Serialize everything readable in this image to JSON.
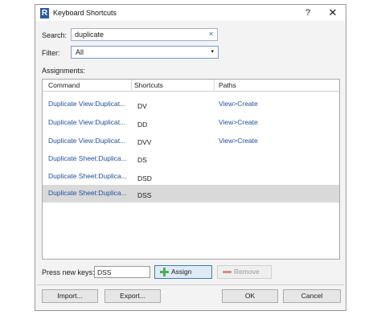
{
  "window": {
    "title": "Keyboard Shortcuts",
    "help_label": "?",
    "close_label": "✕",
    "app_icon_letter": "R"
  },
  "search": {
    "label": "Search:",
    "value": "duplicate",
    "clear_label": "✕"
  },
  "filter": {
    "label": "Filter:",
    "value": "All",
    "chevron": "▾"
  },
  "assignments": {
    "label": "Assignments:",
    "columns": [
      "Command",
      "Shortcuts",
      "Paths"
    ],
    "rows": [
      {
        "command": "Duplicate View:Duplicat...",
        "shortcut": "DV",
        "path": "View>Create",
        "selected": false
      },
      {
        "command": "Duplicate View:Duplicat...",
        "shortcut": "DD",
        "path": "View>Create",
        "selected": false
      },
      {
        "command": "Duplicate View:Duplicat...",
        "shortcut": "DVV",
        "path": "View>Create",
        "selected": false
      },
      {
        "command": "Duplicate Sheet:Duplica...",
        "shortcut": "DS",
        "path": "",
        "selected": false
      },
      {
        "command": "Duplicate Sheet:Duplica...",
        "shortcut": "DSD",
        "path": "",
        "selected": false
      },
      {
        "command": "Duplicate Sheet:Duplica...",
        "shortcut": "DSS",
        "path": "",
        "selected": true
      }
    ]
  },
  "new_keys": {
    "label": "Press new keys:",
    "value": "DSS",
    "assign_label": "Assign",
    "remove_label": "Remove"
  },
  "footer": {
    "import_label": "Import...",
    "export_label": "Export...",
    "ok_label": "OK",
    "cancel_label": "Cancel"
  },
  "colors": {
    "link": "#1f4e9c",
    "selected_row": "#d9d9d9",
    "assign_border": "#3c7fb1",
    "plus_icon": "#4caf50"
  }
}
